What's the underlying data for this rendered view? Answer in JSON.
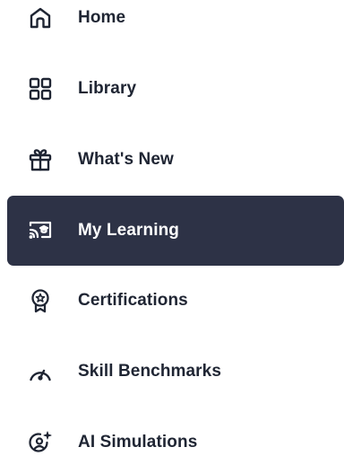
{
  "nav": {
    "items": [
      {
        "label": "Home",
        "icon": "home-icon",
        "active": false
      },
      {
        "label": "Library",
        "icon": "library-grid-icon",
        "active": false
      },
      {
        "label": "What's New",
        "icon": "gift-icon",
        "active": false
      },
      {
        "label": "My Learning",
        "icon": "my-learning-icon",
        "active": true
      },
      {
        "label": "Certifications",
        "icon": "certification-badge-icon",
        "active": false
      },
      {
        "label": "Skill Benchmarks",
        "icon": "gauge-icon",
        "active": false
      },
      {
        "label": "AI Simulations",
        "icon": "ai-simulation-icon",
        "active": false
      }
    ],
    "colors": {
      "active_background": "#2d3246",
      "active_text": "#ffffff",
      "text": "#1f2533"
    }
  }
}
